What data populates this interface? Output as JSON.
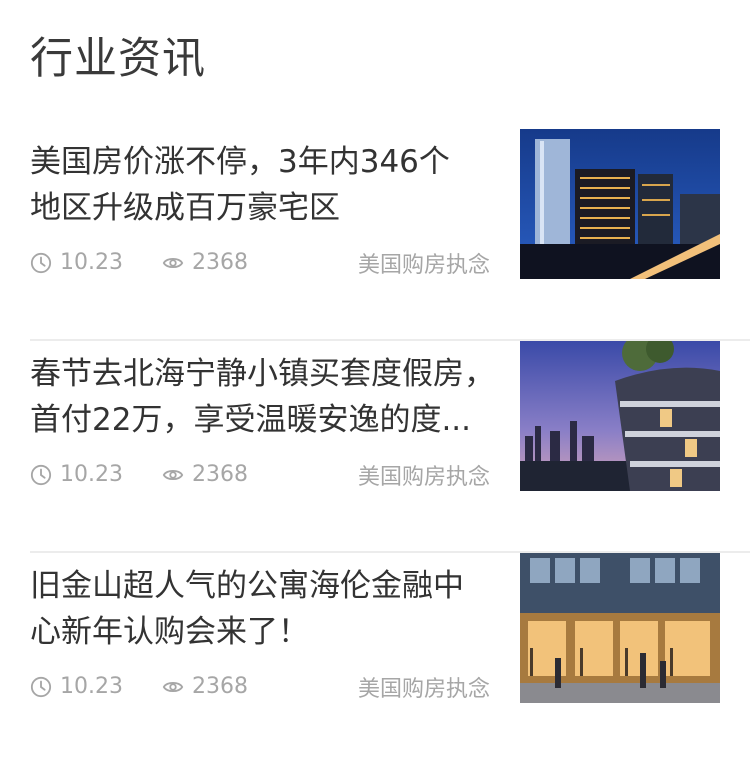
{
  "section": {
    "title": "行业资讯"
  },
  "articles": [
    {
      "title": "美国房价涨不停，3年内346个\n地区升级成百万豪宅区",
      "date": "10.23",
      "views": "2368",
      "source": "美国购房执念",
      "image_icon": "city-night-skyline-image"
    },
    {
      "title": "春节去北海宁静小镇买套度假房，\n首付22万，享受温暖安逸的度...",
      "date": "10.23",
      "views": "2368",
      "source": "美国购房执念",
      "image_icon": "balcony-building-dusk-image"
    },
    {
      "title": "旧金山超人气的公寓海伦金融中\n心新年认购会来了！",
      "date": "10.23",
      "views": "2368",
      "source": "美国购房执念",
      "image_icon": "storefront-street-evening-image"
    }
  ],
  "colors": {
    "title_text": "#333333",
    "meta_text": "#a6a6a6",
    "divider": "#ececec"
  }
}
